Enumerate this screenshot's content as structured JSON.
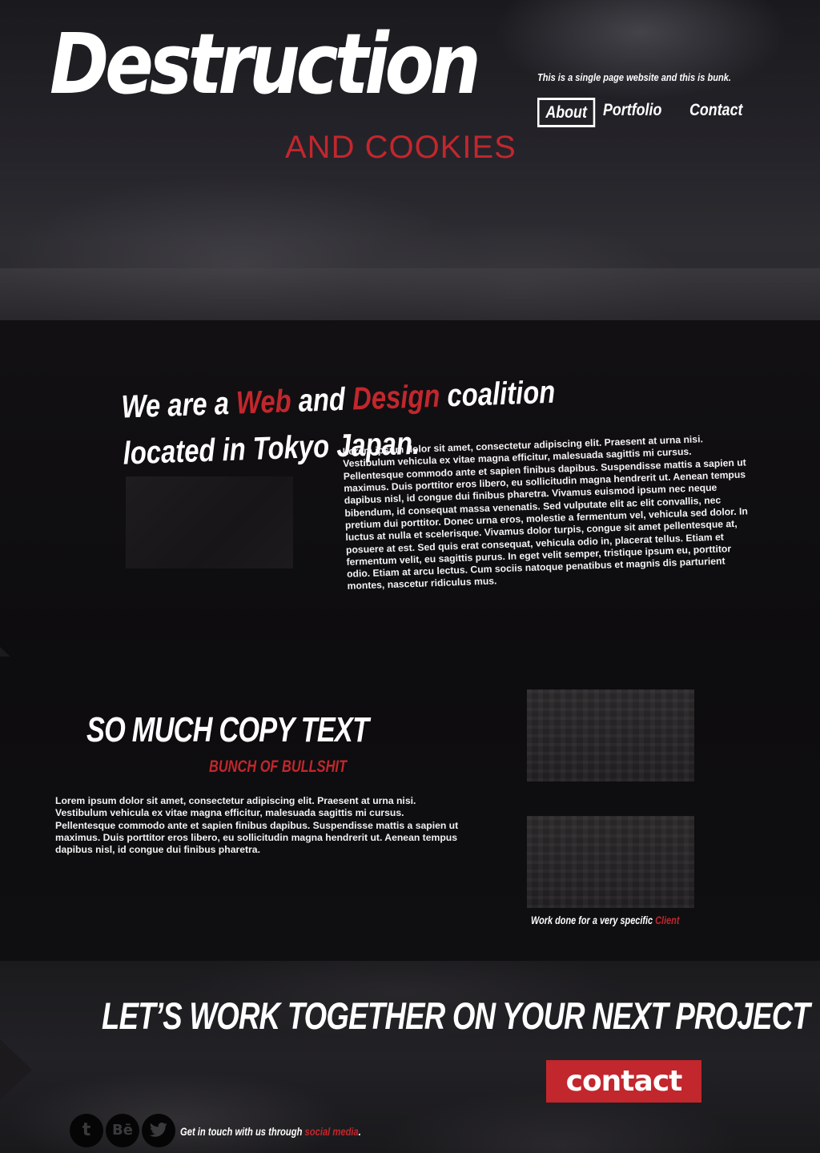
{
  "header": {
    "logo_title": "Destruction",
    "logo_subtitle": "AND COOKIES",
    "tagline": "This is a single page website and this is bunk."
  },
  "nav": {
    "items": [
      {
        "label": "About",
        "active": true
      },
      {
        "label": "Portfolio",
        "active": false
      },
      {
        "label": "Contact",
        "active": false
      }
    ]
  },
  "about": {
    "headline": {
      "part1": "We are a ",
      "highlight1": "Web",
      "part2": " and ",
      "highlight2": "Design",
      "part3": " coalition located in Tokyo Japan."
    },
    "body": "Lorem ipsum dolor sit amet, consectetur adipiscing elit. Praesent at urna nisi. Vestibulum vehicula ex vitae magna efficitur, malesuada sagittis mi cursus. Pellentesque commodo ante et sapien finibus dapibus. Suspendisse mattis a sapien ut maximus. Duis porttitor eros libero, eu sollicitudin magna hendrerit ut. Aenean tempus dapibus nisl, id congue dui finibus pharetra. Vivamus euismod ipsum nec neque bibendum, id consequat massa venenatis. Sed vulputate elit ac elit convallis, nec pretium dui porttitor. Donec urna eros, molestie a fermentum vel, vehicula sed dolor. In luctus at nulla et scelerisque. Vivamus dolor turpis, congue sit amet pellentesque at, posuere at est. Sed quis erat consequat, vehicula odio in, placerat tellus. Etiam et fermentum velit, eu sagittis purus. In eget velit semper, tristique ipsum eu, porttitor odio. Etiam at arcu lectus. Cum sociis natoque penatibus et magnis dis parturient montes, nascetur ridiculus mus."
  },
  "copy": {
    "title": "SO MUCH COPY TEXT",
    "subtitle": "BUNCH OF BULLSHIT",
    "body": "Lorem ipsum dolor sit amet, consectetur adipiscing elit. Praesent at urna nisi. Vestibulum vehicula ex vitae magna efficitur, malesuada sagittis mi cursus. Pellentesque commodo ante et sapien finibus dapibus. Suspendisse mattis a sapien ut maximus. Duis porttitor eros libero, eu sollicitudin magna hendrerit ut. Aenean tempus dapibus nisl, id congue dui finibus pharetra.",
    "caption_prefix": "Work done for a very specific ",
    "caption_highlight": "Client"
  },
  "cta": {
    "title": "LET’S WORK TOGETHER ON YOUR NEXT PROJECT",
    "button_label": "contact"
  },
  "footer": {
    "social_icons": [
      {
        "name": "tumblr-icon",
        "glyph": "t"
      },
      {
        "name": "behance-icon",
        "glyph": "Bē"
      },
      {
        "name": "twitter-icon",
        "glyph": "🐦"
      }
    ],
    "social_text_prefix": "Get in touch with us through ",
    "social_link": "social media",
    "social_text_suffix": "."
  },
  "colors": {
    "accent": "#c1272d",
    "background": "#0d0c0e",
    "text": "#ffffff"
  }
}
